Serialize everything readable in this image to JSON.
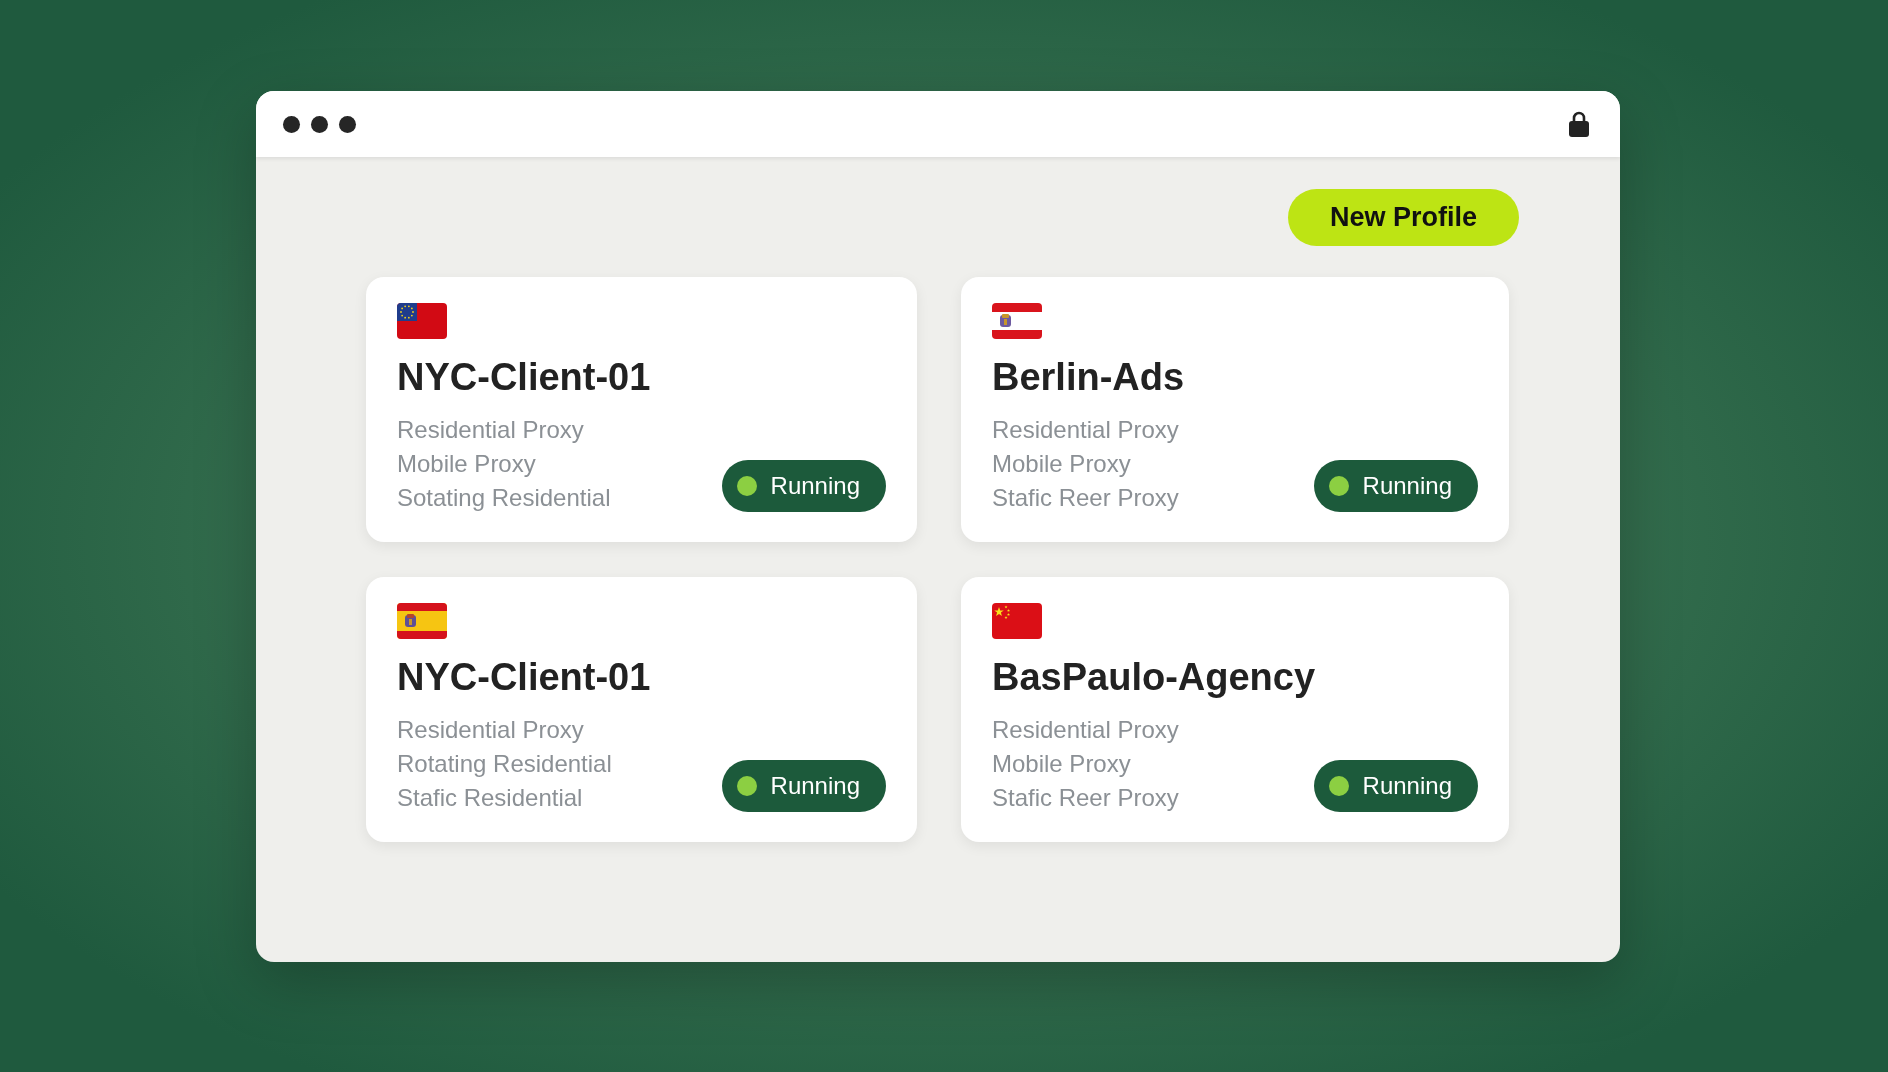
{
  "toolbar": {
    "new_profile_button": "New Profile"
  },
  "profiles": [
    {
      "flag": {
        "kind": "eu-canton"
      },
      "name": "NYC-Client-01",
      "proxies": [
        "Residential Proxy",
        "Mobile Proxy",
        "Sotating Residential"
      ],
      "status": {
        "kind": "running",
        "label": "Running"
      }
    },
    {
      "flag": {
        "kind": "red-white-red-crest"
      },
      "name": "Berlin-Ads",
      "proxies": [
        "Residential Proxy",
        "Mobile Proxy",
        "Stafic Reer Proxy"
      ],
      "status": {
        "kind": "running",
        "label": "Running"
      }
    },
    {
      "flag": {
        "kind": "spain"
      },
      "name": "NYC-Client-01",
      "proxies": [
        "Residential Proxy",
        "Rotating Residential",
        "Stafic Residential"
      ],
      "status": {
        "kind": "running",
        "label": "Running"
      }
    },
    {
      "flag": {
        "kind": "china"
      },
      "name": "BasPaulo-Agency",
      "proxies": [
        "Residential Proxy",
        "Mobile Proxy",
        "Stafic Reer Proxy"
      ],
      "status": {
        "kind": "running",
        "label": "Running"
      }
    }
  ]
}
